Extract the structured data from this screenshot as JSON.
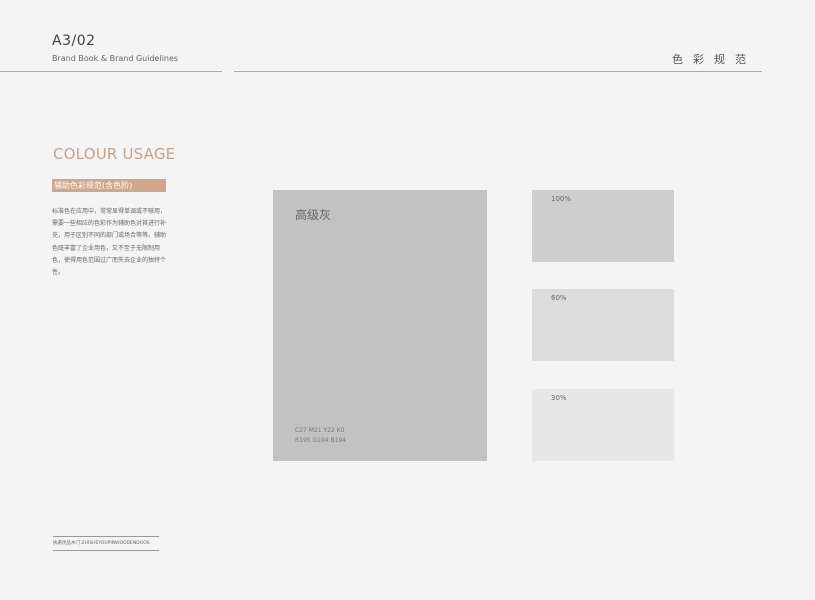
{
  "header": {
    "page_number": "A3/02",
    "subtitle": "Brand Book & Brand Guidelines",
    "section_title": "色彩规范"
  },
  "sidebar": {
    "heading": "COLOUR USAGE",
    "tag": "辅助色彩规范(含色阶)",
    "description": "标准色在应用中，常常显得单调或不够用，需要一些相应的色彩作为辅助色对其进行补充，用于区别不同的部门或场合等等。辅助色既丰富了企业用色，又不至于无限制用色，使得用色范围过广而失去企业的独特个性。"
  },
  "main_swatch": {
    "name": "高级灰",
    "cmyk": "C27  M21  Y22  K0",
    "rgb": "R195  G194  B194",
    "color": "#c3c2c2"
  },
  "tints": [
    {
      "label": "100%",
      "color": "#cfcece"
    },
    {
      "label": "60%",
      "color": "#dcdcdc"
    },
    {
      "label": "30%",
      "color": "#e8e7e7"
    }
  ],
  "colors": {
    "accent": "#c9a184",
    "tag_bg": "#d1a789",
    "background": "#f4f4f4"
  },
  "footer": {
    "text": "执著优品木门 ZHISHEYOUPINWOODENDOOS"
  }
}
